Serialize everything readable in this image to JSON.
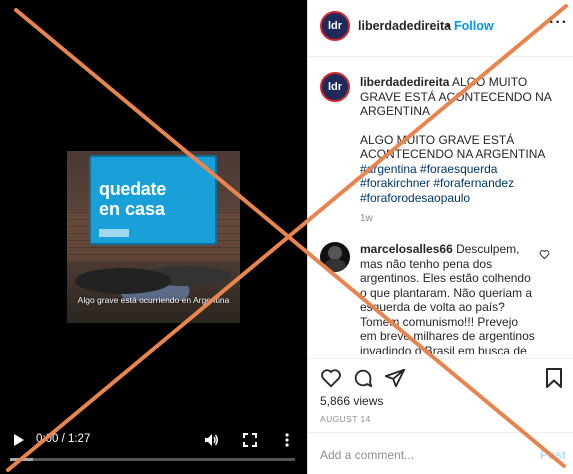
{
  "video": {
    "sign_line1": "quedate",
    "sign_line2": "en casa",
    "caption": "Algo grave está ocurriendo en Argentina",
    "time": "0:00 / 1:27",
    "progress_buffered": 0.08
  },
  "header": {
    "avatar_text": "ldr",
    "username": "liberdadedireita",
    "dot": "•",
    "follow_label": "Follow",
    "more": "···"
  },
  "post": {
    "avatar_text": "ldr",
    "username": "liberdadedireita",
    "line1": " ALGO MUITO GRAVE ESTÁ ACONTECENDO NA ARGENTINA",
    "line2": "ALGO MUITO GRAVE ESTÁ ACONTECENDO NA ARGENTINA",
    "hashtags": "#argentina #foraesquerda #forakirchner #forafernandez #foraforodesaopaulo",
    "time": "1w"
  },
  "comment": {
    "username": "marcelosalles66",
    "text": " Desculpem, mas não tenho pena dos argentinos. Eles estão colhendo o que plantaram. Não queriam a esquerda de volta ao país? Tomem comunismo!!! Prevejo em breve milhares de argentinos invadindo o Brasil em busca de"
  },
  "stats": {
    "views": "5,866 views",
    "date": "AUGUST 14"
  },
  "composer": {
    "placeholder": "Add a comment...",
    "post_label": "Post"
  },
  "colors": {
    "follow": "#0095f6",
    "overlay": "#e8844e"
  }
}
